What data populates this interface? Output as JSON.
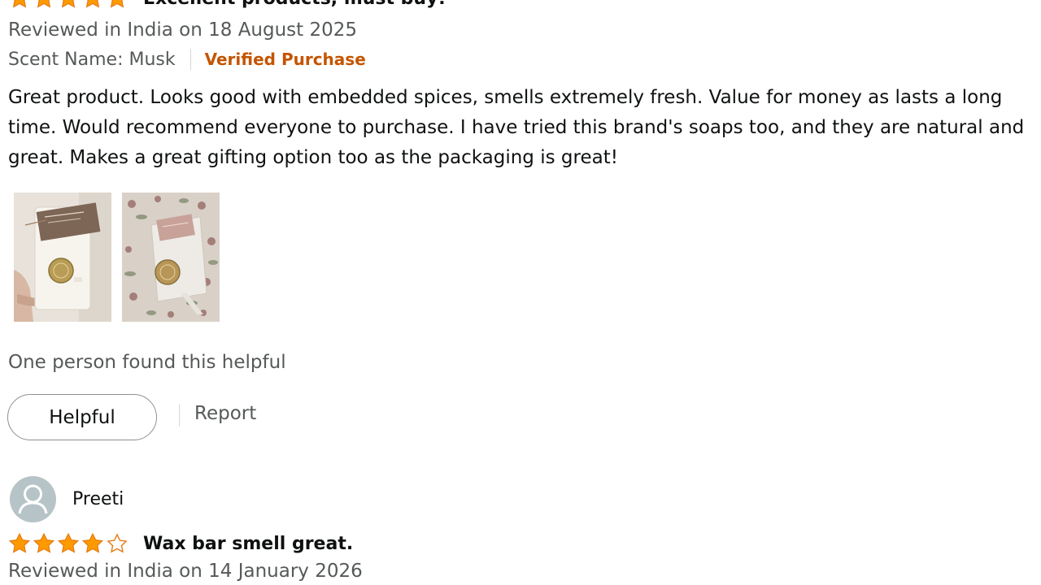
{
  "colors": {
    "star_fill": "#ff9900",
    "star_stroke": "#e47911",
    "verified": "#c45500",
    "meta_text": "#565959",
    "body_text": "#0f1111",
    "avatar_bg": "#b7c4c7"
  },
  "reviews": [
    {
      "rating": 5,
      "title": "Excellent products, must buy!",
      "date_line": "Reviewed in India on 18 August 2025",
      "variant": "Scent Name: Musk",
      "verified_label": "Verified Purchase",
      "body": "Great product. Looks good with embedded spices, smells extremely fresh. Value for money as lasts a long time. Would recommend everyone to purchase. I have tried this brand's soaps too, and they are natural and great. Makes a great gifting option too as the packaging is great!",
      "helpful_text": "One person found this helpful",
      "helpful_button": "Helpful",
      "report_label": "Report"
    },
    {
      "reviewer": "Preeti",
      "avatar_icon": "default-user-avatar-icon",
      "rating": 4,
      "title": "Wax bar smell great.",
      "date_line": "Reviewed in India on 14 January 2026"
    }
  ]
}
